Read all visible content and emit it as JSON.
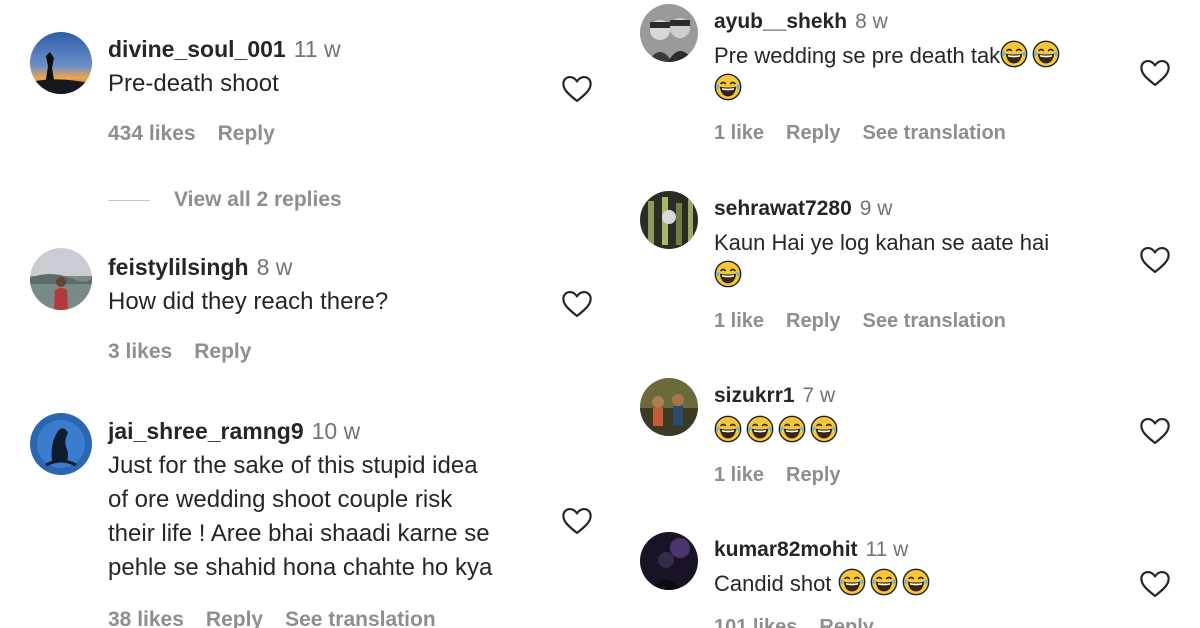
{
  "left_column": {
    "comments": [
      {
        "username": "divine_soul_001",
        "time": "11 w",
        "text_lines": [
          "Pre-death shoot"
        ],
        "likes": "434 likes",
        "reply": "Reply",
        "view_replies": "View all 2 replies"
      },
      {
        "username": "feistylilsingh",
        "time": "8 w",
        "text_lines": [
          "How did they reach there?"
        ],
        "likes": "3 likes",
        "reply": "Reply"
      },
      {
        "username": "jai_shree_ramng9",
        "time": "10 w",
        "text_lines": [
          "Just for the sake of this stupid idea",
          "of ore wedding shoot couple risk",
          "their life ! Aree bhai shaadi karne se",
          "pehle se shahid hona chahte ho kya"
        ],
        "likes": "38 likes",
        "reply": "Reply",
        "see_translation": "See translation"
      }
    ]
  },
  "right_column": {
    "comments": [
      {
        "username": "ayub__shekh",
        "time": "8 w",
        "text_lines": [
          "Pre wedding se pre death tak"
        ],
        "emoji_count_line1": 2,
        "emoji_count_line2": 1,
        "likes": "1 like",
        "reply": "Reply",
        "see_translation": "See translation"
      },
      {
        "username": "sehrawat7280",
        "time": "9 w",
        "text_lines": [
          "Kaun Hai ye log kahan se aate hai"
        ],
        "emoji_count_line2": 1,
        "likes": "1 like",
        "reply": "Reply",
        "see_translation": "See translation"
      },
      {
        "username": "sizukrr1",
        "time": "7 w",
        "emoji_count_line1": 4,
        "likes": "1 like",
        "reply": "Reply"
      },
      {
        "username": "kumar82mohit",
        "time": "11 w",
        "text_lines": [
          "Candid shot"
        ],
        "emoji_count_line1": 3,
        "likes": "101 likes",
        "reply": "Reply",
        "more": "..."
      }
    ]
  },
  "icons": {
    "like": "heart-outline-icon",
    "emoji": "face-with-tears-of-joy-emoji"
  },
  "colors": {
    "text_primary": "#262626",
    "text_secondary": "#8e8e8e",
    "emoji_yellow": "#f7c63b"
  }
}
